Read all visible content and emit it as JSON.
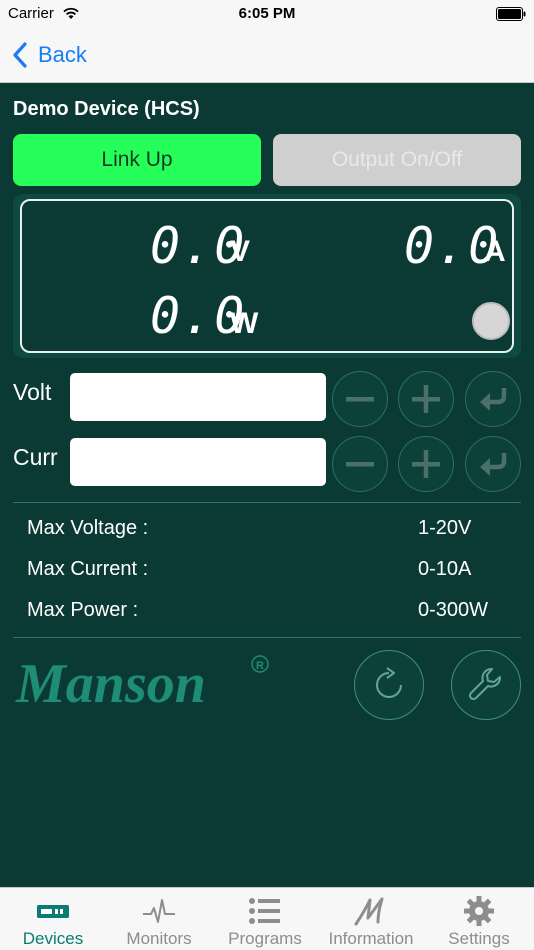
{
  "status_bar": {
    "carrier": "Carrier",
    "time": "6:05 PM"
  },
  "nav": {
    "back_label": "Back"
  },
  "device": {
    "title": "Demo Device (HCS)"
  },
  "buttons": {
    "link": "Link Up",
    "output": "Output On/Off"
  },
  "display": {
    "voltage": "0.0",
    "voltage_unit": "V",
    "current": "0.0",
    "current_unit": "A",
    "power": "0.0",
    "power_unit": "W"
  },
  "controls": {
    "volt_label": "Volt",
    "volt_value": "",
    "curr_label": "Curr",
    "curr_value": ""
  },
  "specs": [
    {
      "label": "Max Voltage :",
      "value": "1-20V"
    },
    {
      "label": "Max Current :",
      "value": "0-10A"
    },
    {
      "label": "Max Power :",
      "value": "0-300W"
    }
  ],
  "logo": {
    "text": "Manson"
  },
  "tabs": [
    {
      "label": "Devices",
      "icon": "device-icon",
      "active": true
    },
    {
      "label": "Monitors",
      "icon": "pulse-icon",
      "active": false
    },
    {
      "label": "Programs",
      "icon": "list-icon",
      "active": false
    },
    {
      "label": "Information",
      "icon": "manson-m-icon",
      "active": false
    },
    {
      "label": "Settings",
      "icon": "gear-icon",
      "active": false
    }
  ],
  "colors": {
    "background": "#0a3a33",
    "accent": "#0b7c73",
    "link_button": "#26ff59",
    "ios_blue": "#1a7cf5"
  }
}
